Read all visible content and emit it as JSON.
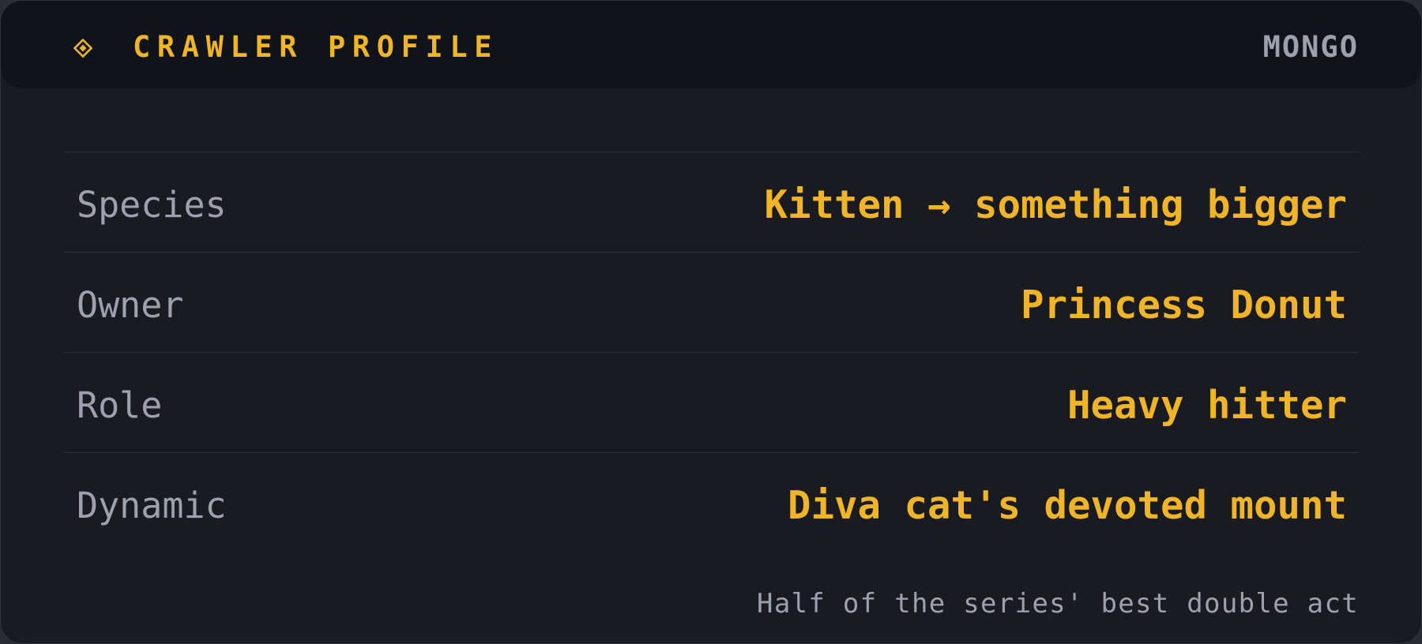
{
  "header": {
    "icon": "diamond-icon",
    "title": "CRAWLER PROFILE",
    "tag": "MONGO"
  },
  "rows": [
    {
      "label": "Species",
      "value": "Kitten → something bigger"
    },
    {
      "label": "Owner",
      "value": "Princess Donut"
    },
    {
      "label": "Role",
      "value": "Heavy hitter"
    },
    {
      "label": "Dynamic",
      "value": "Diva cat's devoted mount"
    }
  ],
  "footnote": "Half of the series' best double act",
  "colors": {
    "accent": "#f0b429",
    "muted_text": "#9ba1ad",
    "card_background": "#191b21",
    "header_background": "#10131a",
    "divider": "#2d3038"
  }
}
